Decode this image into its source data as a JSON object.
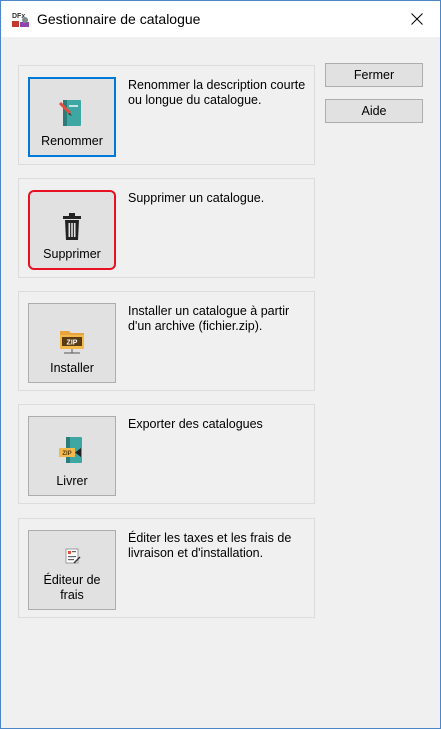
{
  "window": {
    "title": "Gestionnaire de catalogue",
    "app_icon_text": "DFx"
  },
  "side_buttons": {
    "close_label": "Fermer",
    "help_label": "Aide"
  },
  "groups": [
    {
      "button_label": "Renommer",
      "icon": "book-pencil-icon",
      "description": "Renommer la description courte ou longue du catalogue."
    },
    {
      "button_label": "Supprimer",
      "icon": "trash-icon",
      "description": "Supprimer un catalogue."
    },
    {
      "button_label": "Installer",
      "icon": "zip-folder-icon",
      "description": "Installer un catalogue à partir d'un archive (fichier.zip)."
    },
    {
      "button_label": "Livrer",
      "icon": "zip-export-icon",
      "description": "Exporter des catalogues"
    },
    {
      "button_label": "Éditeur de frais",
      "icon": "fees-editor-icon",
      "description": "Éditer les taxes et les frais de livraison et d'installation."
    }
  ],
  "colors": {
    "accent_focus": "#0078d7",
    "highlight_red": "#e81123",
    "window_border": "#4a86c8"
  }
}
